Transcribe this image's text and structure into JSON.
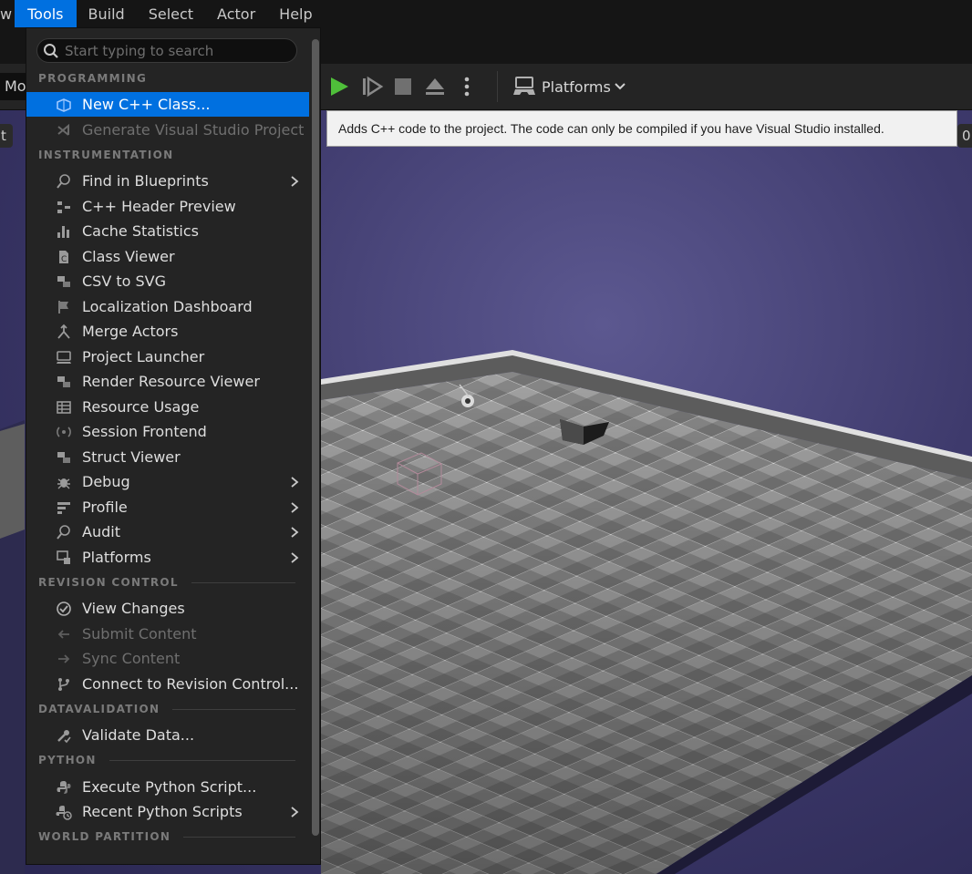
{
  "menubar": {
    "items": [
      "w",
      "Tools",
      "Build",
      "Select",
      "Actor",
      "Help"
    ]
  },
  "toolbar": {
    "mode_label": "Mo",
    "platforms_label": "Platforms"
  },
  "viewport": {
    "left_tab": "t",
    "right_tab": "0"
  },
  "tooltip": {
    "text": "Adds C++ code to the project. The code can only be compiled if you have Visual Studio installed."
  },
  "menu": {
    "search_placeholder": "Start typing to search",
    "sections": {
      "programming": "PROGRAMMING",
      "instrumentation": "INSTRUMENTATION",
      "revision_control": "REVISION CONTROL",
      "datavalidation": "DATAVALIDATION",
      "python": "PYTHON",
      "world_partition": "WORLD PARTITION"
    },
    "items": {
      "new_cpp_class": "New C++ Class...",
      "generate_vs_project": "Generate Visual Studio Project",
      "find_in_blueprints": "Find in Blueprints",
      "cpp_header_preview": "C++ Header Preview",
      "cache_statistics": "Cache Statistics",
      "class_viewer": "Class Viewer",
      "csv_to_svg": "CSV to SVG",
      "localization_dashboard": "Localization Dashboard",
      "merge_actors": "Merge Actors",
      "project_launcher": "Project Launcher",
      "render_resource_viewer": "Render Resource Viewer",
      "resource_usage": "Resource Usage",
      "session_frontend": "Session Frontend",
      "struct_viewer": "Struct Viewer",
      "debug": "Debug",
      "profile": "Profile",
      "audit": "Audit",
      "platforms": "Platforms",
      "view_changes": "View Changes",
      "submit_content": "Submit Content",
      "sync_content": "Sync Content",
      "connect_revision_control": "Connect to Revision Control...",
      "validate_data": "Validate Data...",
      "execute_python_script": "Execute Python Script...",
      "recent_python_scripts": "Recent Python Scripts"
    }
  },
  "colors": {
    "accent": "#0070e0",
    "play_green": "#4fbf3a",
    "menu_bg": "#242424",
    "tooltip_bg": "#f1f1f1",
    "viewport_sky": "#3e3a6c"
  }
}
